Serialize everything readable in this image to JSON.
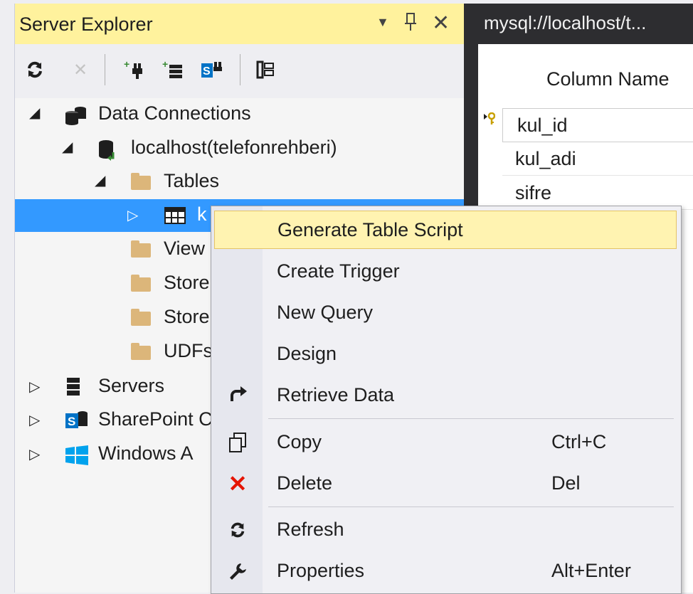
{
  "server_explorer": {
    "title": "Server Explorer",
    "title_buttons": {
      "dropdown_icon": "chevron-down-icon",
      "pin_icon": "pin-icon",
      "close_icon": "close-icon"
    },
    "toolbar": [
      {
        "icon": "refresh-icon"
      },
      {
        "icon": "stop-icon"
      },
      {
        "icon": "connect-to-database-icon"
      },
      {
        "icon": "connect-to-server-icon"
      },
      {
        "icon": "connect-to-sharepoint-icon"
      },
      {
        "icon": "properties-icon"
      }
    ],
    "tree": [
      {
        "label": "Data Connections",
        "expanded": true,
        "level": 0
      },
      {
        "label": "localhost(telefonrehberi)",
        "expanded": true,
        "level": 1
      },
      {
        "label": "Tables",
        "expanded": true,
        "level": 2
      },
      {
        "label": "k",
        "expanded": false,
        "level": 3,
        "selected": true
      },
      {
        "label": "View",
        "level": 3
      },
      {
        "label": "Store",
        "level": 3
      },
      {
        "label": "Store",
        "level": 3
      },
      {
        "label": "UDFs",
        "level": 3
      },
      {
        "label": "Servers",
        "expanded": false,
        "level": 0
      },
      {
        "label": "SharePoint C",
        "expanded": false,
        "level": 0
      },
      {
        "label": "Windows A",
        "expanded": false,
        "level": 0
      }
    ]
  },
  "table_designer": {
    "tab_title": "mysql://localhost/t...",
    "column_header": "Column Name",
    "rows": [
      "kul_id",
      "kul_adi",
      "sifre"
    ]
  },
  "context_menu": {
    "items": [
      {
        "label": "Generate Table Script",
        "highlighted": true
      },
      {
        "label": "Create Trigger"
      },
      {
        "label": "New Query"
      },
      {
        "label": "Design"
      },
      {
        "label": "Retrieve Data",
        "icon": "retrieve-data-icon"
      },
      {
        "label": "Copy",
        "shortcut": "Ctrl+C",
        "icon": "copy-icon"
      },
      {
        "label": "Delete",
        "shortcut": "Del",
        "icon": "delete-icon"
      },
      {
        "label": "Refresh",
        "icon": "refresh-icon"
      },
      {
        "label": "Properties",
        "shortcut": "Alt+Enter",
        "icon": "wrench-icon"
      }
    ]
  },
  "colors": {
    "title_highlight": "#fff29d",
    "selection": "#3399ff",
    "menu_hover": "#fff3b1",
    "delete_red": "#e51400"
  }
}
